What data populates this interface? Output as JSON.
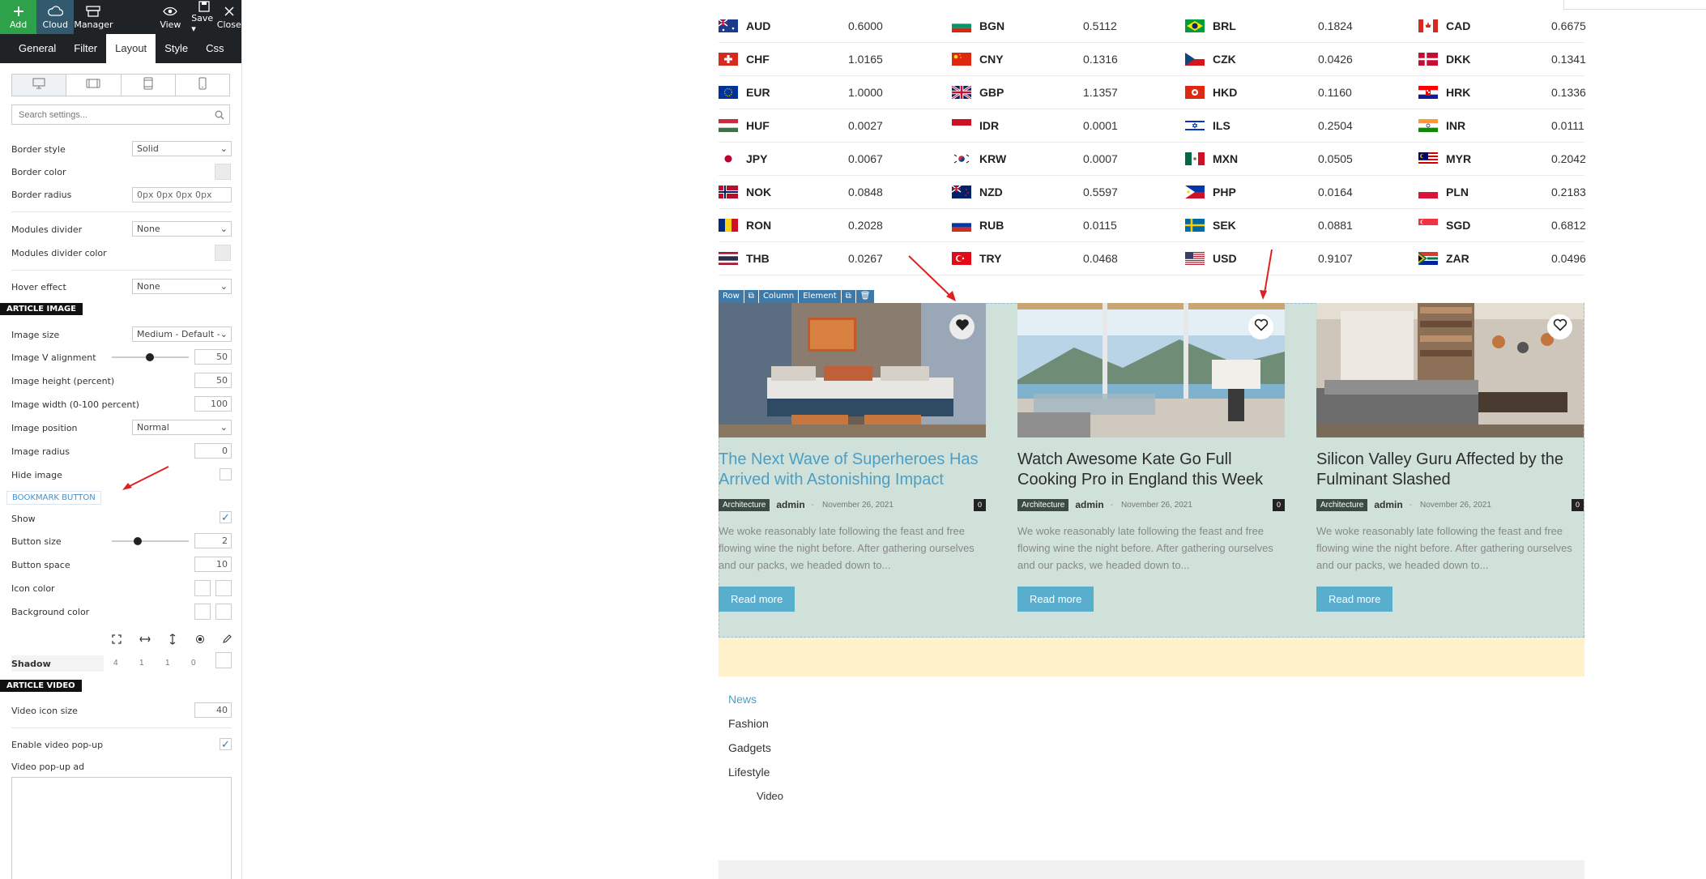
{
  "toolbar": {
    "add": "Add",
    "cloud": "Cloud",
    "manager": "Manager",
    "view": "View",
    "save": "Save ▾",
    "close": "Close"
  },
  "tabs": [
    "General",
    "Filter",
    "Layout",
    "Style",
    "Css"
  ],
  "active_tab": "Layout",
  "search": {
    "placeholder": "Search settings..."
  },
  "settings": {
    "border_style": {
      "label": "Border style",
      "value": "Solid"
    },
    "border_color": {
      "label": "Border color"
    },
    "border_radius": {
      "label": "Border radius",
      "value": "0px 0px 0px 0px"
    },
    "modules_divider": {
      "label": "Modules divider",
      "value": "None"
    },
    "modules_divider_color": {
      "label": "Modules divider color"
    },
    "hover_effect": {
      "label": "Hover effect",
      "value": "None"
    },
    "article_image_heading": "ARTICLE IMAGE",
    "image_size": {
      "label": "Image size",
      "value": "Medium - Default -"
    },
    "image_v_alignment": {
      "label": "Image V alignment",
      "value": "50",
      "slider": 0.35
    },
    "image_height": {
      "label": "Image height (percent)",
      "value": "50"
    },
    "image_width": {
      "label": "Image width (0-100 percent)",
      "value": "100"
    },
    "image_position": {
      "label": "Image position",
      "value": "Normal"
    },
    "image_radius": {
      "label": "Image radius",
      "value": "0"
    },
    "hide_image": {
      "label": "Hide image",
      "checked": false
    },
    "bookmark_heading": "BOOKMARK BUTTON",
    "show": {
      "label": "Show",
      "checked": true
    },
    "button_size": {
      "label": "Button size",
      "value": "2",
      "slider": 0.2
    },
    "button_space": {
      "label": "Button space",
      "value": "10"
    },
    "icon_color": {
      "label": "Icon color"
    },
    "background_color": {
      "label": "Background color"
    },
    "shadow": {
      "label": "Shadow",
      "values": [
        "4",
        "1",
        "1",
        "0"
      ]
    },
    "article_video_heading": "ARTICLE VIDEO",
    "video_icon_size": {
      "label": "Video icon size",
      "value": "40"
    },
    "enable_video_popup": {
      "label": "Enable video pop-up",
      "checked": true
    },
    "video_popup_ad": {
      "label": "Video pop-up ad"
    }
  },
  "currencies": [
    [
      {
        "code": "AUD",
        "rate": "0.6000",
        "flag": "au"
      },
      {
        "code": "BGN",
        "rate": "0.5112",
        "flag": "bg"
      },
      {
        "code": "BRL",
        "rate": "0.1824",
        "flag": "br"
      },
      {
        "code": "CAD",
        "rate": "0.6675",
        "flag": "ca"
      }
    ],
    [
      {
        "code": "CHF",
        "rate": "1.0165",
        "flag": "ch"
      },
      {
        "code": "CNY",
        "rate": "0.1316",
        "flag": "cn"
      },
      {
        "code": "CZK",
        "rate": "0.0426",
        "flag": "cz"
      },
      {
        "code": "DKK",
        "rate": "0.1341",
        "flag": "dk"
      }
    ],
    [
      {
        "code": "EUR",
        "rate": "1.0000",
        "flag": "eu"
      },
      {
        "code": "GBP",
        "rate": "1.1357",
        "flag": "gb"
      },
      {
        "code": "HKD",
        "rate": "0.1160",
        "flag": "hk"
      },
      {
        "code": "HRK",
        "rate": "0.1336",
        "flag": "hr"
      }
    ],
    [
      {
        "code": "HUF",
        "rate": "0.0027",
        "flag": "hu"
      },
      {
        "code": "IDR",
        "rate": "0.0001",
        "flag": "id"
      },
      {
        "code": "ILS",
        "rate": "0.2504",
        "flag": "il"
      },
      {
        "code": "INR",
        "rate": "0.0111",
        "flag": "in"
      }
    ],
    [
      {
        "code": "JPY",
        "rate": "0.0067",
        "flag": "jp"
      },
      {
        "code": "KRW",
        "rate": "0.0007",
        "flag": "kr"
      },
      {
        "code": "MXN",
        "rate": "0.0505",
        "flag": "mx"
      },
      {
        "code": "MYR",
        "rate": "0.2042",
        "flag": "my"
      }
    ],
    [
      {
        "code": "NOK",
        "rate": "0.0848",
        "flag": "no"
      },
      {
        "code": "NZD",
        "rate": "0.5597",
        "flag": "nz"
      },
      {
        "code": "PHP",
        "rate": "0.0164",
        "flag": "ph"
      },
      {
        "code": "PLN",
        "rate": "0.2183",
        "flag": "pl"
      }
    ],
    [
      {
        "code": "RON",
        "rate": "0.2028",
        "flag": "ro"
      },
      {
        "code": "RUB",
        "rate": "0.0115",
        "flag": "ru"
      },
      {
        "code": "SEK",
        "rate": "0.0881",
        "flag": "se"
      },
      {
        "code": "SGD",
        "rate": "0.6812",
        "flag": "sg"
      }
    ],
    [
      {
        "code": "THB",
        "rate": "0.0267",
        "flag": "th"
      },
      {
        "code": "TRY",
        "rate": "0.0468",
        "flag": "tr"
      },
      {
        "code": "USD",
        "rate": "0.9107",
        "flag": "us"
      },
      {
        "code": "ZAR",
        "rate": "0.0496",
        "flag": "za"
      }
    ]
  ],
  "builder_toolbar": [
    "Row",
    "⧉",
    "Column",
    "Element",
    "⧉",
    "🗑"
  ],
  "articles": [
    {
      "title": "The Next Wave of Superheroes Has Arrived with Astonishing Impact",
      "category": "Architecture",
      "author": "admin",
      "date": "November 26, 2021",
      "comments": "0",
      "excerpt": "We woke reasonably late following the feast and free flowing wine the night before. After gathering ourselves and our packs, we headed down to...",
      "button": "Read more",
      "bookmarked": true
    },
    {
      "title": "Watch Awesome Kate Go Full Cooking Pro in England this Week",
      "category": "Architecture",
      "author": "admin",
      "date": "November 26, 2021",
      "comments": "0",
      "excerpt": "We woke reasonably late following the feast and free flowing wine the night before. After gathering ourselves and our packs, we headed down to...",
      "button": "Read more",
      "bookmarked": false
    },
    {
      "title": "Silicon Valley Guru Affected by the Fulminant Slashed",
      "category": "Architecture",
      "author": "admin",
      "date": "November 26, 2021",
      "comments": "0",
      "excerpt": "We woke reasonably late following the feast and free flowing wine the night before. After gathering ourselves and our packs, we headed down to...",
      "button": "Read more",
      "bookmarked": false
    }
  ],
  "nav": [
    "News",
    "Fashion",
    "Gadgets",
    "Lifestyle",
    "Video"
  ],
  "colors": {
    "accent": "#4d9ec5",
    "button": "#5aaecd",
    "panel_dark": "#1f2325",
    "add_green": "#2ea24b",
    "arrow_red": "#e02020"
  }
}
